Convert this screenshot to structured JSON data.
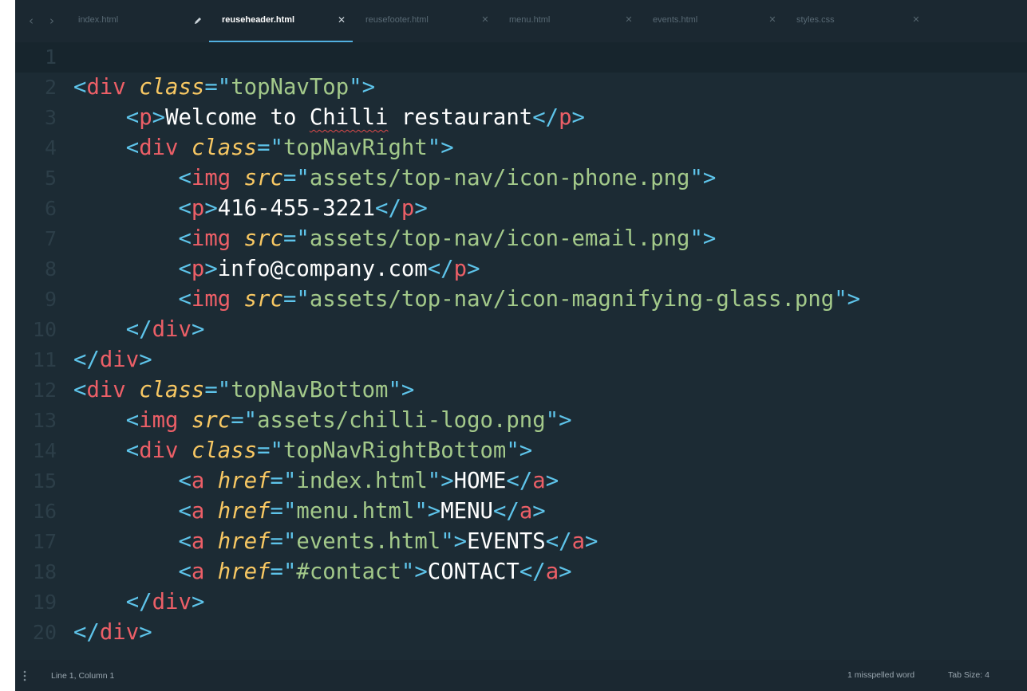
{
  "tabs": [
    {
      "label": "index.html",
      "active": false,
      "dirty": false
    },
    {
      "label": "reuseheader.html",
      "active": true,
      "dirty": false
    },
    {
      "label": "reusefooter.html",
      "active": false,
      "dirty": false
    },
    {
      "label": "menu.html",
      "active": false,
      "dirty": false
    },
    {
      "label": "events.html",
      "active": false,
      "dirty": false
    },
    {
      "label": "styles.css",
      "active": false,
      "dirty": false
    }
  ],
  "icons": {
    "back": "chevron-left-icon",
    "forward": "chevron-right-icon",
    "edit": "pencil-icon",
    "close": "close-icon",
    "menu": "vertical-dots-icon"
  },
  "line_numbers": [
    "1",
    "2",
    "3",
    "4",
    "5",
    "6",
    "7",
    "8",
    "9",
    "10",
    "11",
    "12",
    "13",
    "14",
    "15",
    "16",
    "17",
    "18",
    "19",
    "20"
  ],
  "code_lines": [
    [],
    [
      [
        "pu",
        "<"
      ],
      [
        "tg",
        "div"
      ],
      [
        "tx",
        " "
      ],
      [
        "at",
        "class"
      ],
      [
        "pu",
        "=\""
      ],
      [
        "st",
        "topNavTop"
      ],
      [
        "pu",
        "\">"
      ]
    ],
    [
      [
        "tx",
        "    "
      ],
      [
        "pu",
        "<"
      ],
      [
        "tg",
        "p"
      ],
      [
        "pu",
        ">"
      ],
      [
        "tx",
        "Welcome to "
      ],
      [
        "tx_spell",
        "Chilli"
      ],
      [
        "tx",
        " restaurant"
      ],
      [
        "pu",
        "</"
      ],
      [
        "tg",
        "p"
      ],
      [
        "pu",
        ">"
      ]
    ],
    [
      [
        "tx",
        "    "
      ],
      [
        "pu",
        "<"
      ],
      [
        "tg",
        "div"
      ],
      [
        "tx",
        " "
      ],
      [
        "at",
        "class"
      ],
      [
        "pu",
        "=\""
      ],
      [
        "st",
        "topNavRight"
      ],
      [
        "pu",
        "\">"
      ]
    ],
    [
      [
        "tx",
        "        "
      ],
      [
        "pu",
        "<"
      ],
      [
        "tg",
        "img"
      ],
      [
        "tx",
        " "
      ],
      [
        "at",
        "src"
      ],
      [
        "pu",
        "=\""
      ],
      [
        "st",
        "assets/top-nav/icon-phone.png"
      ],
      [
        "pu",
        "\">"
      ]
    ],
    [
      [
        "tx",
        "        "
      ],
      [
        "pu",
        "<"
      ],
      [
        "tg",
        "p"
      ],
      [
        "pu",
        ">"
      ],
      [
        "tx",
        "416-455-3221"
      ],
      [
        "pu",
        "</"
      ],
      [
        "tg",
        "p"
      ],
      [
        "pu",
        ">"
      ]
    ],
    [
      [
        "tx",
        "        "
      ],
      [
        "pu",
        "<"
      ],
      [
        "tg",
        "img"
      ],
      [
        "tx",
        " "
      ],
      [
        "at",
        "src"
      ],
      [
        "pu",
        "=\""
      ],
      [
        "st",
        "assets/top-nav/icon-email.png"
      ],
      [
        "pu",
        "\">"
      ]
    ],
    [
      [
        "tx",
        "        "
      ],
      [
        "pu",
        "<"
      ],
      [
        "tg",
        "p"
      ],
      [
        "pu",
        ">"
      ],
      [
        "tx",
        "info@company.com"
      ],
      [
        "pu",
        "</"
      ],
      [
        "tg",
        "p"
      ],
      [
        "pu",
        ">"
      ]
    ],
    [
      [
        "tx",
        "        "
      ],
      [
        "pu",
        "<"
      ],
      [
        "tg",
        "img"
      ],
      [
        "tx",
        " "
      ],
      [
        "at",
        "src"
      ],
      [
        "pu",
        "=\""
      ],
      [
        "st",
        "assets/top-nav/icon-magnifying-glass.png"
      ],
      [
        "pu",
        "\">"
      ]
    ],
    [
      [
        "tx",
        "    "
      ],
      [
        "pu",
        "</"
      ],
      [
        "tg",
        "div"
      ],
      [
        "pu",
        ">"
      ]
    ],
    [
      [
        "pu",
        "</"
      ],
      [
        "tg",
        "div"
      ],
      [
        "pu",
        ">"
      ]
    ],
    [
      [
        "pu",
        "<"
      ],
      [
        "tg",
        "div"
      ],
      [
        "tx",
        " "
      ],
      [
        "at",
        "class"
      ],
      [
        "pu",
        "=\""
      ],
      [
        "st",
        "topNavBottom"
      ],
      [
        "pu",
        "\">"
      ]
    ],
    [
      [
        "tx",
        "    "
      ],
      [
        "pu",
        "<"
      ],
      [
        "tg",
        "img"
      ],
      [
        "tx",
        " "
      ],
      [
        "at",
        "src"
      ],
      [
        "pu",
        "=\""
      ],
      [
        "st",
        "assets/chilli-logo.png"
      ],
      [
        "pu",
        "\">"
      ]
    ],
    [
      [
        "tx",
        "    "
      ],
      [
        "pu",
        "<"
      ],
      [
        "tg",
        "div"
      ],
      [
        "tx",
        " "
      ],
      [
        "at",
        "class"
      ],
      [
        "pu",
        "=\""
      ],
      [
        "st",
        "topNavRightBottom"
      ],
      [
        "pu",
        "\">"
      ]
    ],
    [
      [
        "tx",
        "        "
      ],
      [
        "pu",
        "<"
      ],
      [
        "tg",
        "a"
      ],
      [
        "tx",
        " "
      ],
      [
        "at",
        "href"
      ],
      [
        "pu",
        "=\""
      ],
      [
        "st",
        "index.html"
      ],
      [
        "pu",
        "\">"
      ],
      [
        "tx",
        "HOME"
      ],
      [
        "pu",
        "</"
      ],
      [
        "tg",
        "a"
      ],
      [
        "pu",
        ">"
      ]
    ],
    [
      [
        "tx",
        "        "
      ],
      [
        "pu",
        "<"
      ],
      [
        "tg",
        "a"
      ],
      [
        "tx",
        " "
      ],
      [
        "at",
        "href"
      ],
      [
        "pu",
        "=\""
      ],
      [
        "st",
        "menu.html"
      ],
      [
        "pu",
        "\">"
      ],
      [
        "tx",
        "MENU"
      ],
      [
        "pu",
        "</"
      ],
      [
        "tg",
        "a"
      ],
      [
        "pu",
        ">"
      ]
    ],
    [
      [
        "tx",
        "        "
      ],
      [
        "pu",
        "<"
      ],
      [
        "tg",
        "a"
      ],
      [
        "tx",
        " "
      ],
      [
        "at",
        "href"
      ],
      [
        "pu",
        "=\""
      ],
      [
        "st",
        "events.html"
      ],
      [
        "pu",
        "\">"
      ],
      [
        "tx",
        "EVENTS"
      ],
      [
        "pu",
        "</"
      ],
      [
        "tg",
        "a"
      ],
      [
        "pu",
        ">"
      ]
    ],
    [
      [
        "tx",
        "        "
      ],
      [
        "pu",
        "<"
      ],
      [
        "tg",
        "a"
      ],
      [
        "tx",
        " "
      ],
      [
        "at",
        "href"
      ],
      [
        "pu",
        "=\""
      ],
      [
        "st",
        "#contact"
      ],
      [
        "pu",
        "\">"
      ],
      [
        "tx",
        "CONTACT"
      ],
      [
        "pu",
        "</"
      ],
      [
        "tg",
        "a"
      ],
      [
        "pu",
        ">"
      ]
    ],
    [
      [
        "tx",
        "    "
      ],
      [
        "pu",
        "</"
      ],
      [
        "tg",
        "div"
      ],
      [
        "pu",
        ">"
      ]
    ],
    [
      [
        "pu",
        "</"
      ],
      [
        "tg",
        "div"
      ],
      [
        "pu",
        ">"
      ]
    ]
  ],
  "current_line": 1,
  "colors": {
    "background": "#1c2b34",
    "punctuation": "#5ec4ea",
    "tag": "#ec5f67",
    "attribute": "#f8c863",
    "string": "#a3c98a",
    "text": "#ffffff",
    "accent": "#52b0e0"
  },
  "statusbar": {
    "cursor_position": "Line 1, Column 1",
    "spell_status": "1 misspelled word",
    "tab_size": "Tab Size: 4"
  }
}
